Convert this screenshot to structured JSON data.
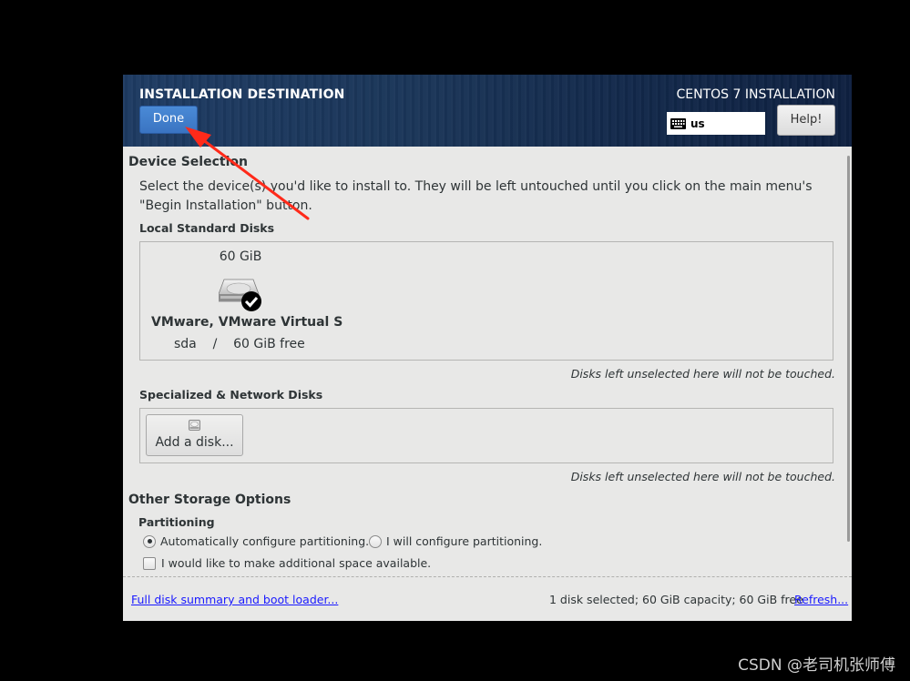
{
  "header": {
    "title": "INSTALLATION DESTINATION",
    "done_label": "Done",
    "product": "CENTOS 7 INSTALLATION",
    "keyboard_layout": "us",
    "help_label": "Help!"
  },
  "device_selection": {
    "heading": "Device Selection",
    "description": "Select the device(s) you'd like to install to.  They will be left untouched until you click on the main menu's \"Begin Installation\" button.",
    "local_heading": "Local Standard Disks",
    "disks": [
      {
        "size": "60 GiB",
        "name": "VMware, VMware Virtual S",
        "device": "sda",
        "separator": "/",
        "free": "60 GiB free",
        "selected": true
      }
    ],
    "local_note": "Disks left unselected here will not be touched.",
    "specialized_heading": "Specialized & Network Disks",
    "add_disk_label": "Add a disk...",
    "specialized_note": "Disks left unselected here will not be touched."
  },
  "other_storage": {
    "heading": "Other Storage Options",
    "partitioning_heading": "Partitioning",
    "auto_label": "Automatically configure partitioning.",
    "manual_label": "I will configure partitioning.",
    "selected": "auto",
    "space_label": "I would like to make additional space available.",
    "space_checked": false
  },
  "footer": {
    "summary_link": "Full disk summary and boot loader...",
    "status": "1 disk selected; 60 GiB capacity; 60 GiB free",
    "refresh_link": "Refresh..."
  },
  "annotation": {
    "arrow_color": "#ff2a1a"
  },
  "watermark": "CSDN @老司机张师傅"
}
